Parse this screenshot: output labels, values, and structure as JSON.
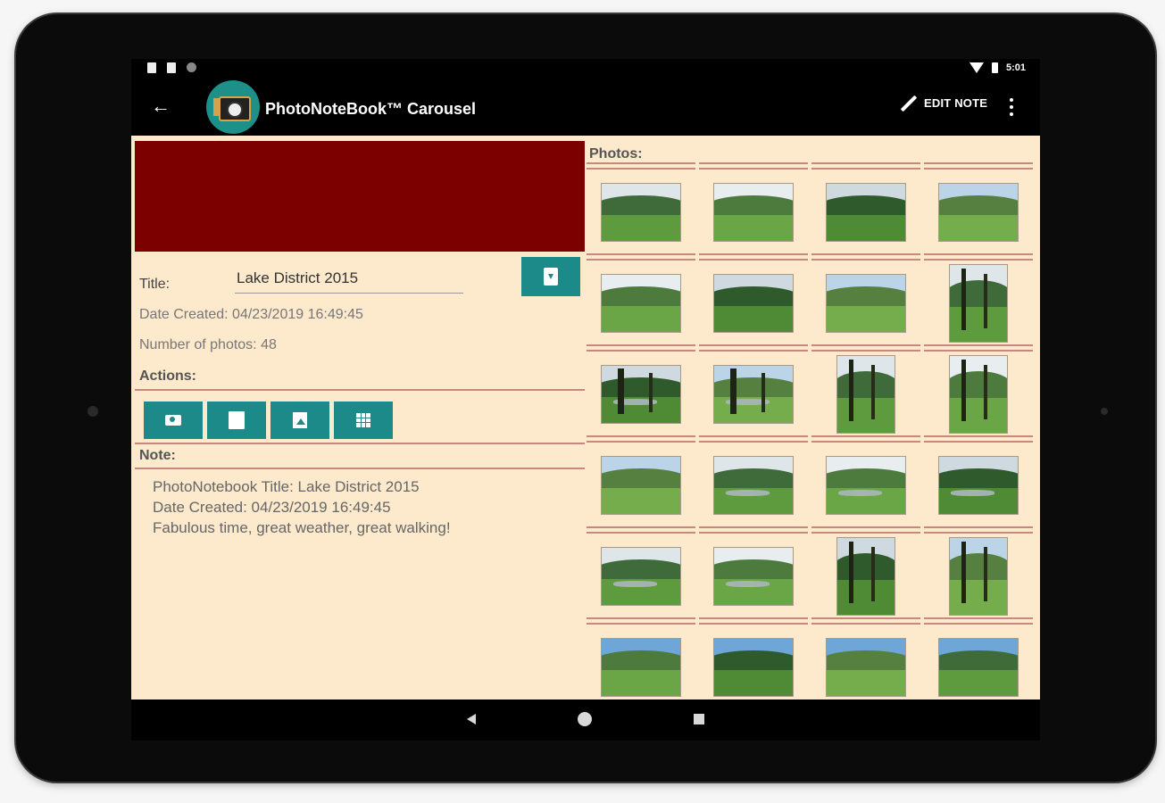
{
  "status_bar": {
    "time": "5:01"
  },
  "app_bar": {
    "back_icon": "arrow-back-icon",
    "title": "PhotoNoteBook™ Carousel",
    "edit_note_label": "EDIT NOTE",
    "overflow_icon": "more-vert-icon"
  },
  "details": {
    "title_label": "Title:",
    "title_value": "Lake District 2015",
    "date_created": "Date Created: 04/23/2019  16:49:45",
    "number_of_photos": "Number of photos: 48",
    "actions_label": "Actions:",
    "actions": [
      {
        "icon": "camera-icon"
      },
      {
        "icon": "folder-files-icon"
      },
      {
        "icon": "picture-icon"
      },
      {
        "icon": "grid-icon"
      }
    ],
    "note_label": "Note:",
    "note_lines": [
      "PhotoNotebook Title: Lake District 2015",
      "Date Created: 04/23/2019  16:49:45",
      "Fabulous time, great weather, great walking!"
    ]
  },
  "photos": {
    "label": "Photos:"
  },
  "colors": {
    "banner": "#7d0000",
    "accent": "#1d8a8a",
    "background": "#fde9cc",
    "rule": "#c9877d"
  }
}
